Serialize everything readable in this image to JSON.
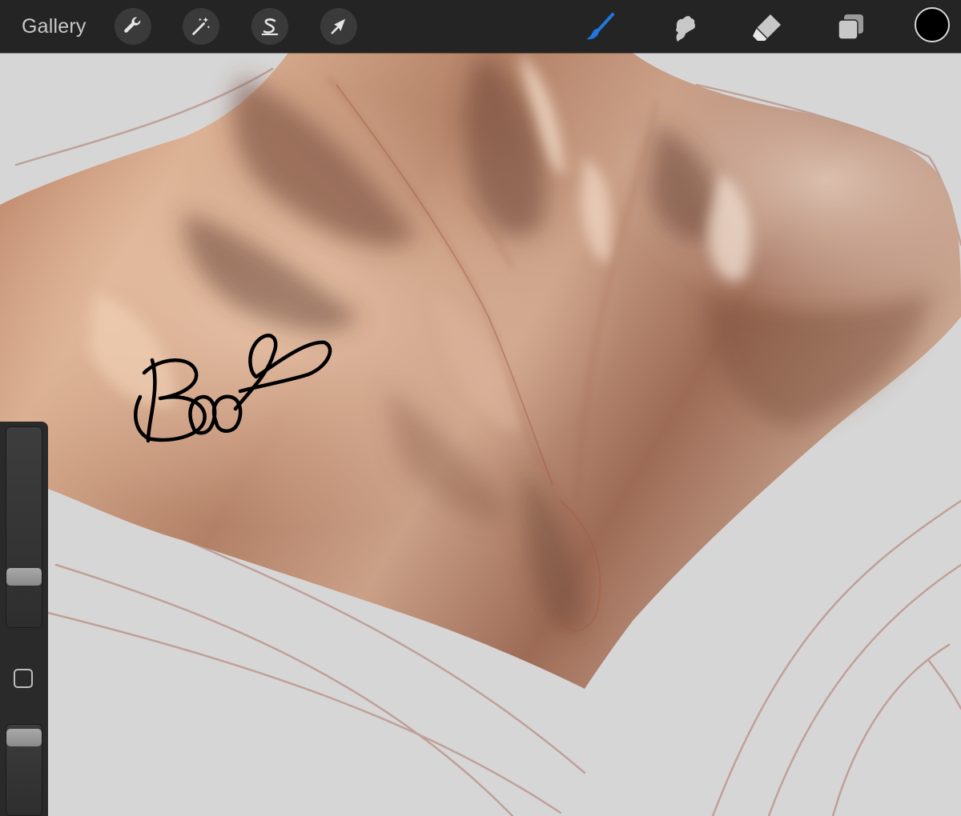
{
  "toolbar": {
    "gallery_label": "Gallery",
    "actions": [
      {
        "icon": "wrench-icon"
      },
      {
        "icon": "magic-wand-icon"
      },
      {
        "icon": "selection-s-icon"
      },
      {
        "icon": "transform-arrow-icon"
      }
    ],
    "tools": [
      {
        "icon": "brush-icon",
        "active": true
      },
      {
        "icon": "smudge-icon",
        "active": false
      },
      {
        "icon": "eraser-icon",
        "active": false
      },
      {
        "icon": "layers-icon",
        "active": false
      }
    ],
    "active_color": "#000000",
    "active_tool_color": "#1e78e0",
    "inactive_tool_color": "#c8c8c8"
  },
  "sidebar": {
    "brush_size_level": 0.25,
    "brush_opacity_level": 0.9
  },
  "canvas": {
    "background_color": "#d7d6d6",
    "skin_color": "#b98a70",
    "sketch_line_color": "#b0867a",
    "signature_ink_color": "#000000"
  }
}
